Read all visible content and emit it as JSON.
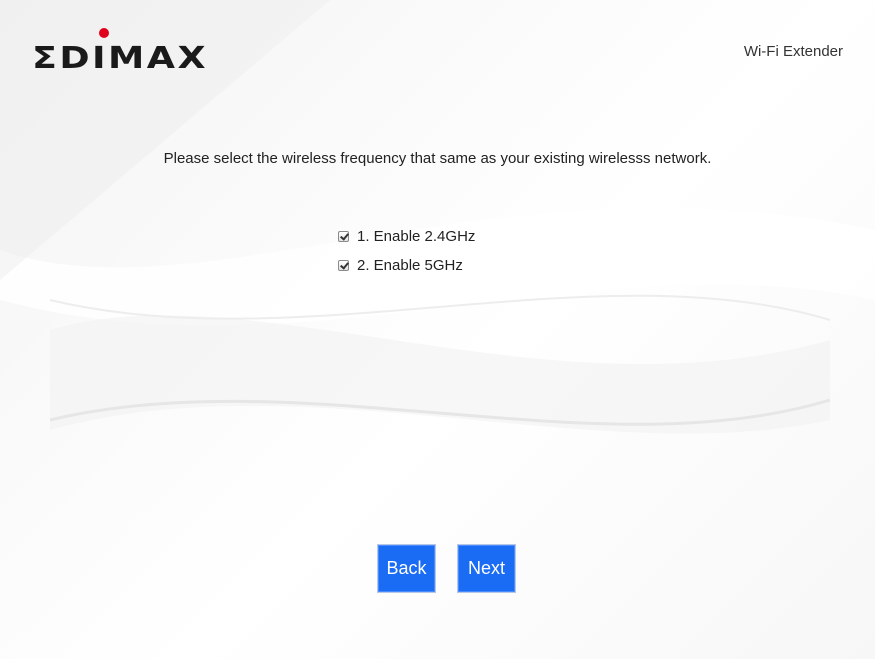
{
  "brand": {
    "logo_text": "EDIMAX",
    "product_label": "Wi-Fi Extender"
  },
  "wizard": {
    "instruction": "Please select the wireless frequency that same as your existing wirelesss network.",
    "options": [
      {
        "label": "1. Enable 2.4GHz",
        "checked": true
      },
      {
        "label": "2. Enable 5GHz",
        "checked": true
      }
    ],
    "back_label": "Back",
    "next_label": "Next"
  },
  "colors": {
    "button": "#1a6cf5",
    "logo": "#1a1a1a",
    "logo_dot": "#e0001b"
  }
}
